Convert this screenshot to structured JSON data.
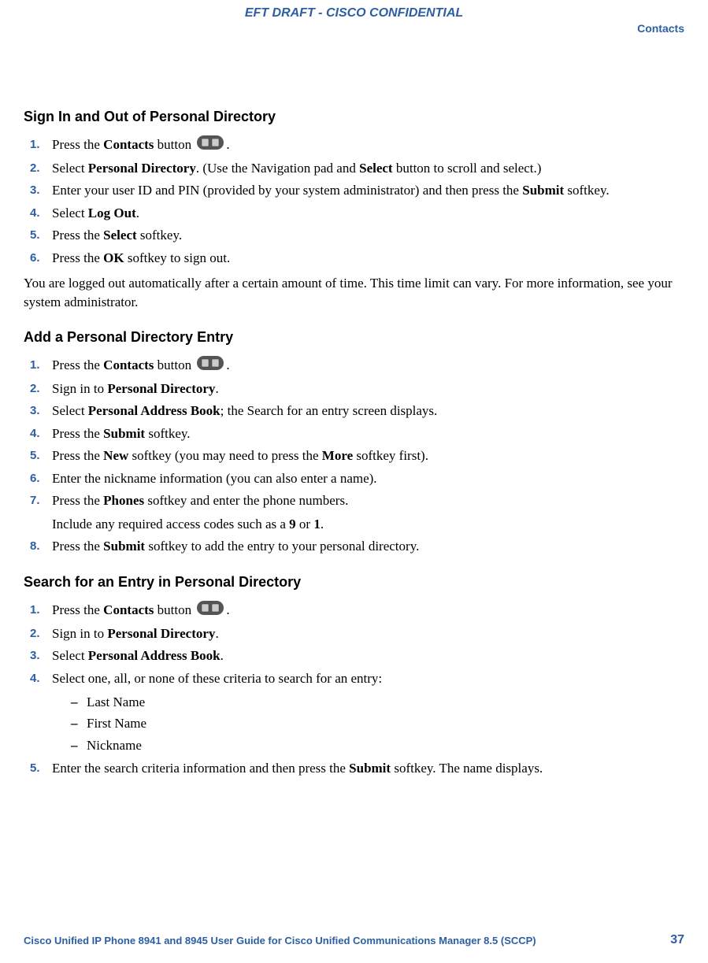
{
  "header": {
    "draft": "EFT DRAFT - CISCO CONFIDENTIAL",
    "section": "Contacts"
  },
  "sections": {
    "signin": {
      "title": "Sign In and Out of Personal Directory",
      "steps": {
        "s1a": "Press the ",
        "s1b": "Contacts",
        "s1c": " button ",
        "s1d": ".",
        "s2a": "Select ",
        "s2b": "Personal Directory",
        "s2c": ". (Use the Navigation pad and ",
        "s2d": "Select",
        "s2e": " button to scroll and select.)",
        "s3a": "Enter your user ID and PIN (provided by your system administrator) and then press the ",
        "s3b": "Submit",
        "s3c": " softkey.",
        "s4a": "Select ",
        "s4b": "Log Out",
        "s4c": ".",
        "s5a": "Press the ",
        "s5b": "Select",
        "s5c": " softkey.",
        "s6a": "Press the ",
        "s6b": "OK",
        "s6c": " softkey to sign out."
      },
      "note": "You are logged out automatically after a certain amount of time. This time limit can vary. For more information, see your system administrator."
    },
    "add": {
      "title": "Add a Personal Directory Entry",
      "steps": {
        "s1a": "Press the ",
        "s1b": "Contacts",
        "s1c": " button ",
        "s1d": ".",
        "s2a": "Sign in to ",
        "s2b": "Personal Directory",
        "s2c": ".",
        "s3a": "Select ",
        "s3b": "Personal Address Book",
        "s3c": "; the Search for an entry screen displays.",
        "s4a": "Press the ",
        "s4b": "Submit",
        "s4c": " softkey.",
        "s5a": "Press the ",
        "s5b": "New",
        "s5c": " softkey (you may need to press the ",
        "s5d": "More",
        "s5e": " softkey first).",
        "s6": "Enter the nickname information (you can also enter a name).",
        "s7a": "Press the ",
        "s7b": "Phones",
        "s7c": " softkey and enter the phone numbers.",
        "s7sub_a": "Include any required access codes such as a ",
        "s7sub_b": "9",
        "s7sub_c": " or ",
        "s7sub_d": "1",
        "s7sub_e": ".",
        "s8a": "Press the ",
        "s8b": "Submit",
        "s8c": " softkey to add the entry to your personal directory."
      }
    },
    "search": {
      "title": "Search for an Entry in Personal Directory",
      "steps": {
        "s1a": "Press the ",
        "s1b": "Contacts",
        "s1c": " button ",
        "s1d": ".",
        "s2a": "Sign in to ",
        "s2b": "Personal Directory",
        "s2c": ".",
        "s3a": "Select ",
        "s3b": "Personal Address Book",
        "s3c": ".",
        "s4": "Select one, all, or none of these criteria to search for an entry:",
        "s4_items": {
          "a": "Last Name",
          "b": "First Name",
          "c": "Nickname"
        },
        "s5a": "Enter the search criteria information and then press the ",
        "s5b": "Submit",
        "s5c": " softkey. The name displays."
      }
    }
  },
  "nums": {
    "n1": "1.",
    "n2": "2.",
    "n3": "3.",
    "n4": "4.",
    "n5": "5.",
    "n6": "6.",
    "n7": "7.",
    "n8": "8."
  },
  "footer": {
    "title": "Cisco Unified IP Phone 8941 and 8945 User Guide for Cisco Unified Communications Manager 8.5 (SCCP)",
    "page": "37"
  }
}
